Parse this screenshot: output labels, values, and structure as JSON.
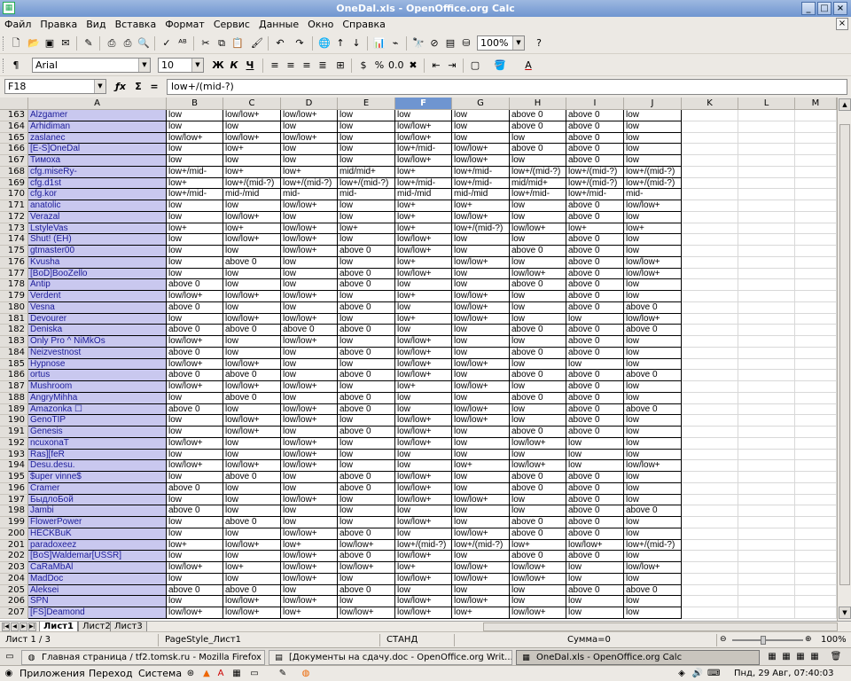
{
  "window": {
    "title": "OneDal.xls - OpenOffice.org Calc"
  },
  "menu": [
    "Файл",
    "Правка",
    "Вид",
    "Вставка",
    "Формат",
    "Сервис",
    "Данные",
    "Окно",
    "Справка"
  ],
  "toolbar": {
    "zoom": "100%",
    "font": "Arial",
    "size": "10"
  },
  "formula": {
    "cellref": "F18",
    "content": "low+/(mid-?)"
  },
  "columns": [
    "A",
    "B",
    "C",
    "D",
    "E",
    "F",
    "G",
    "H",
    "I",
    "J",
    "K",
    "L",
    "M"
  ],
  "selected_column": "F",
  "rows": [
    {
      "n": "163",
      "name": "Alzgamer",
      "v": [
        "low",
        "low/low+",
        "low/low+",
        "low",
        "low",
        "low",
        "above 0",
        "above 0",
        "low"
      ]
    },
    {
      "n": "164",
      "name": "Arhidiman",
      "v": [
        "low",
        "low",
        "low",
        "low",
        "low/low+",
        "low",
        "above 0",
        "above 0",
        "low"
      ]
    },
    {
      "n": "165",
      "name": "zaslanec",
      "v": [
        "low/low+",
        "low/low+",
        "low/low+",
        "low",
        "low/low+",
        "low",
        "low",
        "above 0",
        "low"
      ]
    },
    {
      "n": "166",
      "name": "[E-S]OneDal",
      "v": [
        "low",
        "low+",
        "low",
        "low",
        "low+/mid-",
        "low/low+",
        "above 0",
        "above 0",
        "low"
      ]
    },
    {
      "n": "167",
      "name": "Тимоха",
      "v": [
        "low",
        "low",
        "low",
        "low",
        "low/low+",
        "low/low+",
        "low",
        "above 0",
        "low"
      ]
    },
    {
      "n": "168",
      "name": "cfg.miseRy-",
      "v": [
        "low+/mid-",
        "low+",
        "low+",
        "mid/mid+",
        "low+",
        "low+/mid-",
        "low+/(mid-?)",
        "low+/(mid-?)",
        "low+/(mid-?)"
      ]
    },
    {
      "n": "169",
      "name": "cfg.d1st",
      "v": [
        "low+",
        "low+/(mid-?)",
        "low+/(mid-?)",
        "low+/(mid-?)",
        "low+/mid-",
        "low+/mid-",
        "mid/mid+",
        "low+/(mid-?)",
        "low+/(mid-?)"
      ]
    },
    {
      "n": "170",
      "name": "cfg.kor",
      "v": [
        "low+/mid-",
        "mid-/mid",
        "mid-",
        "mid-",
        "mid-/mid",
        "mid-/mid",
        "low+/mid-",
        "low+/mid-",
        "mid-"
      ]
    },
    {
      "n": "171",
      "name": "anatolic",
      "v": [
        "low",
        "low",
        "low/low+",
        "low",
        "low+",
        "low+",
        "low",
        "above 0",
        "low/low+"
      ]
    },
    {
      "n": "172",
      "name": "Verazal",
      "v": [
        "low",
        "low/low+",
        "low",
        "low",
        "low+",
        "low/low+",
        "low",
        "above 0",
        "low"
      ]
    },
    {
      "n": "173",
      "name": "LstyleVas",
      "v": [
        "low+",
        "low+",
        "low/low+",
        "low+",
        "low+",
        "low+/(mid-?)",
        "low/low+",
        "low+",
        "low+"
      ]
    },
    {
      "n": "174",
      "name": "Shut! (EH)",
      "v": [
        "low",
        "low/low+",
        "low/low+",
        "low",
        "low/low+",
        "low",
        "low",
        "above 0",
        "low"
      ]
    },
    {
      "n": "175",
      "name": "gtmaster00",
      "v": [
        "low",
        "low",
        "low/low+",
        "above 0",
        "low/low+",
        "low",
        "above 0",
        "above 0",
        "low"
      ]
    },
    {
      "n": "176",
      "name": "Kvusha",
      "v": [
        "low",
        "above 0",
        "low",
        "low",
        "low+",
        "low/low+",
        "low",
        "above 0",
        "low/low+"
      ]
    },
    {
      "n": "177",
      "name": "[BoD]BooZello",
      "v": [
        "low",
        "low",
        "low",
        "above 0",
        "low/low+",
        "low",
        "low/low+",
        "above 0",
        "low/low+"
      ]
    },
    {
      "n": "178",
      "name": "Antip",
      "v": [
        "above 0",
        "low",
        "low",
        "above 0",
        "low",
        "low",
        "above 0",
        "above 0",
        "low"
      ]
    },
    {
      "n": "179",
      "name": "Verdent",
      "v": [
        "low/low+",
        "low/low+",
        "low/low+",
        "low",
        "low+",
        "low/low+",
        "low",
        "above 0",
        "low"
      ]
    },
    {
      "n": "180",
      "name": "Vesna",
      "v": [
        "above 0",
        "low",
        "low",
        "above 0",
        "low",
        "low/low+",
        "low",
        "above 0",
        "above 0"
      ]
    },
    {
      "n": "181",
      "name": "Devourer",
      "v": [
        "low",
        "low/low+",
        "low/low+",
        "low",
        "low+",
        "low/low+",
        "low",
        "low",
        "low/low+"
      ]
    },
    {
      "n": "182",
      "name": "Deniska",
      "v": [
        "above 0",
        "above 0",
        "above 0",
        "above 0",
        "low",
        "low",
        "above 0",
        "above 0",
        "above 0"
      ]
    },
    {
      "n": "183",
      "name": "Only Pro ^ NiMkOs",
      "v": [
        "low/low+",
        "low",
        "low/low+",
        "low",
        "low/low+",
        "low",
        "low",
        "above 0",
        "low"
      ]
    },
    {
      "n": "184",
      "name": "Neizvestnost",
      "v": [
        "above 0",
        "low",
        "low",
        "above 0",
        "low/low+",
        "low",
        "above 0",
        "above 0",
        "low"
      ]
    },
    {
      "n": "185",
      "name": "Hypnose",
      "v": [
        "low/low+",
        "low/low+",
        "low",
        "low",
        "low/low+",
        "low/low+",
        "low",
        "low",
        "low"
      ]
    },
    {
      "n": "186",
      "name": "ortus",
      "v": [
        "above 0",
        "above 0",
        "low",
        "above 0",
        "low/low+",
        "low",
        "above 0",
        "above 0",
        "above 0"
      ]
    },
    {
      "n": "187",
      "name": "Mushroom",
      "v": [
        "low/low+",
        "low/low+",
        "low/low+",
        "low",
        "low+",
        "low/low+",
        "low",
        "above 0",
        "low"
      ]
    },
    {
      "n": "188",
      "name": "AngryMihha",
      "v": [
        "low",
        "above 0",
        "low",
        "above 0",
        "low",
        "low",
        "above 0",
        "above 0",
        "low"
      ]
    },
    {
      "n": "189",
      "name": "Amazonka ☐",
      "v": [
        "above 0",
        "low",
        "low/low+",
        "above 0",
        "low",
        "low/low+",
        "low",
        "above 0",
        "above 0"
      ]
    },
    {
      "n": "190",
      "name": "GenoTIP",
      "v": [
        "low",
        "low/low+",
        "low/low+",
        "low",
        "low/low+",
        "low/low+",
        "low",
        "above 0",
        "low"
      ]
    },
    {
      "n": "191",
      "name": "Genesis",
      "v": [
        "low",
        "low/low+",
        "low",
        "above 0",
        "low/low+",
        "low",
        "above 0",
        "above 0",
        "low"
      ]
    },
    {
      "n": "192",
      "name": "ncuxonaT",
      "v": [
        "low/low+",
        "low",
        "low/low+",
        "low",
        "low/low+",
        "low",
        "low/low+",
        "low",
        "low"
      ]
    },
    {
      "n": "193",
      "name": "Ras][feR",
      "v": [
        "low",
        "low",
        "low/low+",
        "low",
        "low",
        "low",
        "low",
        "low",
        "low"
      ]
    },
    {
      "n": "194",
      "name": "Desu.desu.",
      "v": [
        "low/low+",
        "low/low+",
        "low/low+",
        "low",
        "low",
        "low+",
        "low/low+",
        "low",
        "low/low+"
      ]
    },
    {
      "n": "195",
      "name": "$uper vinne$",
      "v": [
        "low",
        "above 0",
        "low",
        "above 0",
        "low/low+",
        "low",
        "above 0",
        "above 0",
        "low"
      ]
    },
    {
      "n": "196",
      "name": "Cramer",
      "v": [
        "above 0",
        "low",
        "low",
        "above 0",
        "low/low+",
        "low",
        "above 0",
        "above 0",
        "low"
      ]
    },
    {
      "n": "197",
      "name": "БыдлоБой",
      "v": [
        "low",
        "low",
        "low/low+",
        "low",
        "low/low+",
        "low/low+",
        "low",
        "above 0",
        "low"
      ]
    },
    {
      "n": "198",
      "name": "Jambi",
      "v": [
        "above 0",
        "low",
        "low",
        "low",
        "low",
        "low",
        "low",
        "above 0",
        "above 0"
      ]
    },
    {
      "n": "199",
      "name": "FlowerPower",
      "v": [
        "low",
        "above 0",
        "low",
        "low",
        "low/low+",
        "low",
        "above 0",
        "above 0",
        "low"
      ]
    },
    {
      "n": "200",
      "name": "HECKBuK",
      "v": [
        "low",
        "low",
        "low/low+",
        "above 0",
        "low",
        "low/low+",
        "above 0",
        "above 0",
        "low"
      ]
    },
    {
      "n": "201",
      "name": "paradoxeez",
      "v": [
        "low+",
        "low/low+",
        "low+",
        "low/low+",
        "low+/(mid-?)",
        "low+/(mid-?)",
        "low+",
        "low/low+",
        "low+/(mid-?)"
      ]
    },
    {
      "n": "202",
      "name": "[BoS]Waldemar[USSR]",
      "v": [
        "low",
        "low",
        "low/low+",
        "above 0",
        "low/low+",
        "low",
        "above 0",
        "above 0",
        "low"
      ]
    },
    {
      "n": "203",
      "name": "CaRaMbAl",
      "v": [
        "low/low+",
        "low+",
        "low/low+",
        "low/low+",
        "low+",
        "low/low+",
        "low/low+",
        "low",
        "low/low+"
      ]
    },
    {
      "n": "204",
      "name": "MadDoc",
      "v": [
        "low",
        "low",
        "low/low+",
        "low",
        "low/low+",
        "low/low+",
        "low/low+",
        "low",
        "low"
      ]
    },
    {
      "n": "205",
      "name": "Aleksei",
      "v": [
        "above 0",
        "above 0",
        "low",
        "above 0",
        "low",
        "low",
        "low",
        "above 0",
        "above 0"
      ]
    },
    {
      "n": "206",
      "name": "SPN",
      "v": [
        "low",
        "low/low+",
        "low/low+",
        "low",
        "low/low+",
        "low/low+",
        "low",
        "low",
        "low"
      ]
    },
    {
      "n": "207",
      "name": "[FS]Deamond",
      "v": [
        "low/low+",
        "low/low+",
        "low+",
        "low/low+",
        "low/low+",
        "low+",
        "low/low+",
        "low",
        "low"
      ]
    }
  ],
  "tabs": [
    "Лист1",
    "Лист2",
    "Лист3"
  ],
  "status": {
    "sheet": "Лист 1 / 3",
    "style": "PageStyle_Лист1",
    "mode": "СТАНД",
    "sum": "Сумма=0",
    "zoom": "100%"
  },
  "taskbar": [
    {
      "label": "Главная страница / tf2.tomsk.ru - Mozilla Firefox",
      "icon": "firefox-icon"
    },
    {
      "label": "[Документы на сдачу.doc - OpenOffice.org Writ...",
      "icon": "writer-icon"
    },
    {
      "label": "OneDal.xls - OpenOffice.org Calc",
      "icon": "calc-icon"
    }
  ],
  "panel": {
    "apps": "Приложения",
    "places": "Переход",
    "system": "Система",
    "clock": "Пнд, 29 Авг, 07:40:03"
  }
}
